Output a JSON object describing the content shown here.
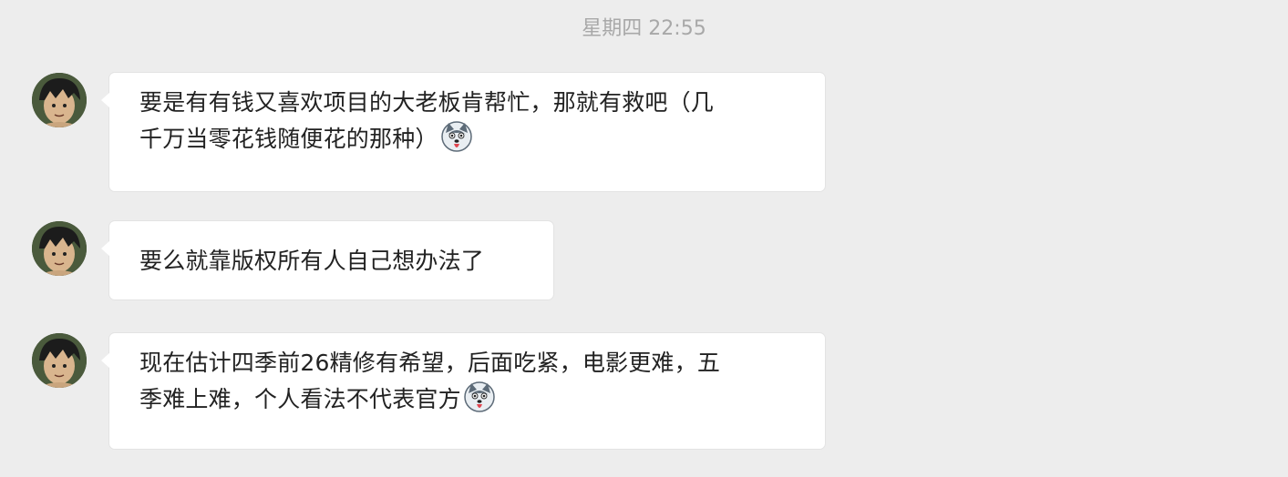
{
  "timestamp": "星期四 22:55",
  "messages": [
    {
      "lines": [
        "要是有有钱又喜欢项目的大老板肯帮忙，那就有救吧（几",
        "千万当零花钱随便花的那种）"
      ],
      "emoji": "husky-emoji-icon"
    },
    {
      "lines": [
        "要么就靠版权所有人自己想办法了"
      ]
    },
    {
      "lines": [
        "现在估计四季前26精修有希望，后面吃紧，电影更难，五",
        "季难上难，个人看法不代表官方"
      ],
      "emoji": "husky-emoji-icon"
    }
  ],
  "colors": {
    "background": "#ededed",
    "bubble": "#ffffff",
    "text": "#222222",
    "timestamp": "#a8a8a8"
  }
}
